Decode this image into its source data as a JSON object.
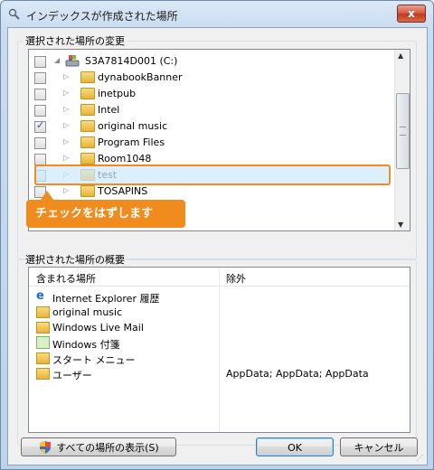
{
  "window": {
    "title": "インデックスが作成された場所",
    "close_glyph": "x"
  },
  "change_section": {
    "label": "選択された場所の変更",
    "items": [
      {
        "label": "S3A7814D001 (C:)",
        "checked": false,
        "icon": "drive-icon",
        "indent": 0
      },
      {
        "label": "dynabookBanner",
        "checked": false,
        "icon": "folder-icon",
        "indent": 1
      },
      {
        "label": "inetpub",
        "checked": false,
        "icon": "folder-icon",
        "indent": 1
      },
      {
        "label": "Intel",
        "checked": false,
        "icon": "folder-icon",
        "indent": 1
      },
      {
        "label": "original music",
        "checked": true,
        "icon": "folder-icon",
        "indent": 1
      },
      {
        "label": "Program Files",
        "checked": false,
        "icon": "folder-icon",
        "indent": 1
      },
      {
        "label": "Room1048",
        "checked": false,
        "icon": "folder-icon",
        "indent": 1
      },
      {
        "label": "test",
        "checked": false,
        "icon": "folder-icon",
        "indent": 1
      },
      {
        "label": "TOSAPINS",
        "checked": false,
        "icon": "folder-icon",
        "indent": 1
      }
    ]
  },
  "callout": {
    "text": "チェックをはずします",
    "color": "#f08c1e"
  },
  "summary_section": {
    "label": "選択された場所の概要",
    "headers": {
      "included": "含まれる場所",
      "excluded": "除外"
    },
    "rows": [
      {
        "name": "Internet Explorer 履歴",
        "icon": "ie-icon",
        "excluded": ""
      },
      {
        "name": "original music",
        "icon": "folder-icon",
        "excluded": ""
      },
      {
        "name": "Windows Live Mail",
        "icon": "folder-icon",
        "excluded": ""
      },
      {
        "name": "Windows 付箋",
        "icon": "note-icon",
        "excluded": ""
      },
      {
        "name": "スタート メニュー",
        "icon": "folder-icon",
        "excluded": ""
      },
      {
        "name": "ユーザー",
        "icon": "folder-icon",
        "excluded": "AppData; AppData; AppData"
      }
    ]
  },
  "buttons": {
    "show_all": "すべての場所の表示(S)",
    "ok": "OK",
    "cancel": "キャンセル"
  }
}
